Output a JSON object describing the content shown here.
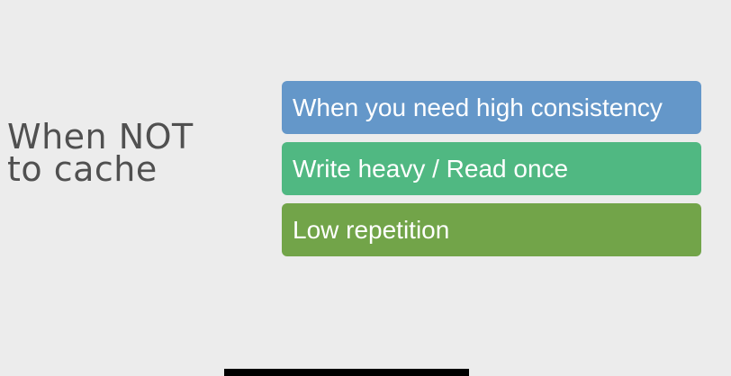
{
  "slide": {
    "title": "When NOT\nto cache",
    "items": [
      {
        "label": "When you need high consistency",
        "color": "#6497c9"
      },
      {
        "label": "Write heavy / Read once",
        "color": "#50b882"
      },
      {
        "label": "Low repetition",
        "color": "#72a449"
      }
    ]
  },
  "colors": {
    "background": "#ececec",
    "title_text": "#505050",
    "item_text": "#ffffff"
  }
}
